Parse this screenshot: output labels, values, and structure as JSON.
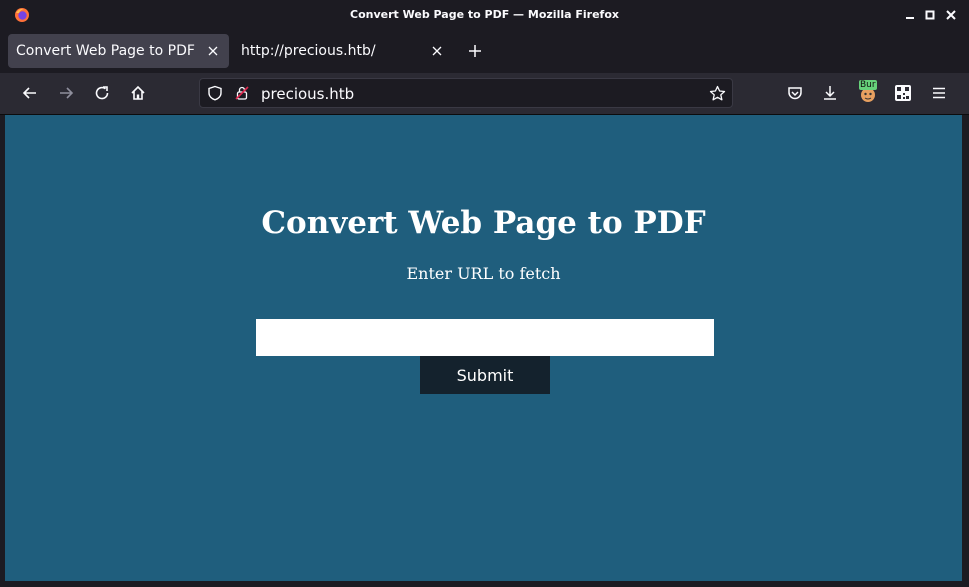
{
  "window": {
    "title": "Convert Web Page to PDF — Mozilla Firefox"
  },
  "tabs": [
    {
      "label": "Convert Web Page to PDF",
      "active": true
    },
    {
      "label": "http://precious.htb/",
      "active": false
    }
  ],
  "nav": {
    "url": "precious.htb",
    "extension_badge": "Bur"
  },
  "page": {
    "heading": "Convert Web Page to PDF",
    "subheading": "Enter URL to fetch",
    "url_input_value": "",
    "submit_label": "Submit"
  },
  "icons": {
    "firefox": "firefox-logo-icon",
    "back": "back-arrow-icon",
    "forward": "forward-arrow-icon",
    "reload": "reload-icon",
    "home": "home-icon",
    "shield": "tracking-protection-shield-icon",
    "insecure": "insecure-lock-icon",
    "bookmark": "bookmark-star-icon",
    "pocket": "pocket-icon",
    "download": "download-icon",
    "qr": "qr-code-icon",
    "menu": "hamburger-menu-icon"
  },
  "colors": {
    "page_background": "#1f5e7d",
    "submit_background": "#14222d",
    "browser_chrome": "#1c1b22",
    "toolbar": "#2b2a33",
    "active_tab": "#42414d"
  }
}
